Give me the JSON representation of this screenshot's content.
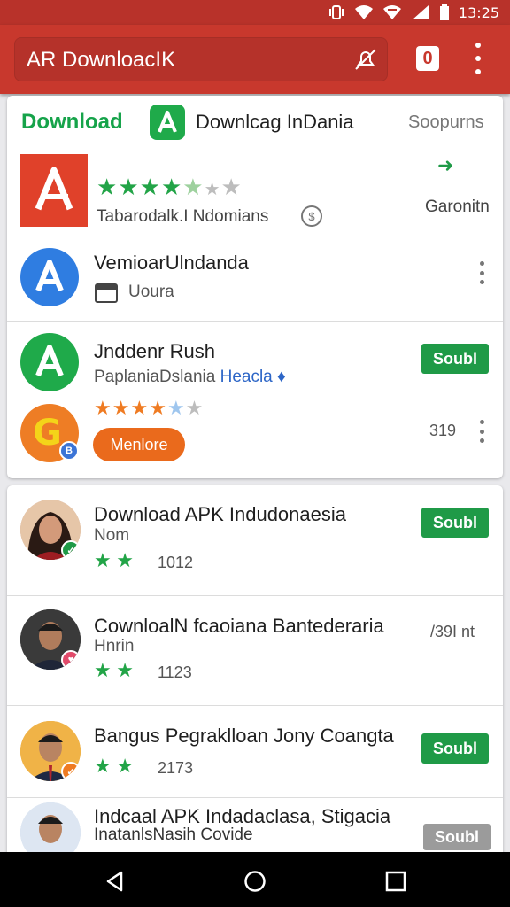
{
  "status_bar": {
    "time": "13:25"
  },
  "app_bar": {
    "search_text": "AR DownloacIK",
    "badge": "0"
  },
  "colors": {
    "app_bar": "#c8382d",
    "accent_green": "#1f9a47",
    "star_green": "#22a447",
    "star_orange": "#ef7b22",
    "pill_orange": "#ea6a1c"
  },
  "section_header": {
    "label": "Download",
    "app_name": "Downlcag InDania",
    "right_label": "Soopurns"
  },
  "featured": {
    "rating_text": "Tabarodalk.I Ndomians",
    "side_label": "Garonitn",
    "stars_full": 5,
    "stars_total": 7
  },
  "items": [
    {
      "title": "VemioarUlndanda",
      "subtitle": "Uoura"
    },
    {
      "title": "Jnddenr Rush",
      "subtitle": "PaplaniaDslania",
      "subtitle_link": "Heacla",
      "install_label": "Soubl",
      "stars": 4,
      "pill_label": "Menlore",
      "count": "319"
    }
  ],
  "people": [
    {
      "title": "Download APK Indudonaesia",
      "subtitle": "Nom",
      "count": "1012",
      "install_label": "Soubl"
    },
    {
      "title": "CownloalN fcaoiana Bantederaria",
      "subtitle": "Hnrin",
      "count": "1123",
      "right_text": "/39I nt"
    },
    {
      "title": "Bangus Pegraklloan Jony Coangta",
      "subtitle": "",
      "count": "2173",
      "install_label": "Soubl"
    },
    {
      "title": "Indcaal APK Indadaclasa, Stigacia",
      "subtitle": "InatanlsNasih Covide",
      "install_label": "Soubl"
    }
  ]
}
